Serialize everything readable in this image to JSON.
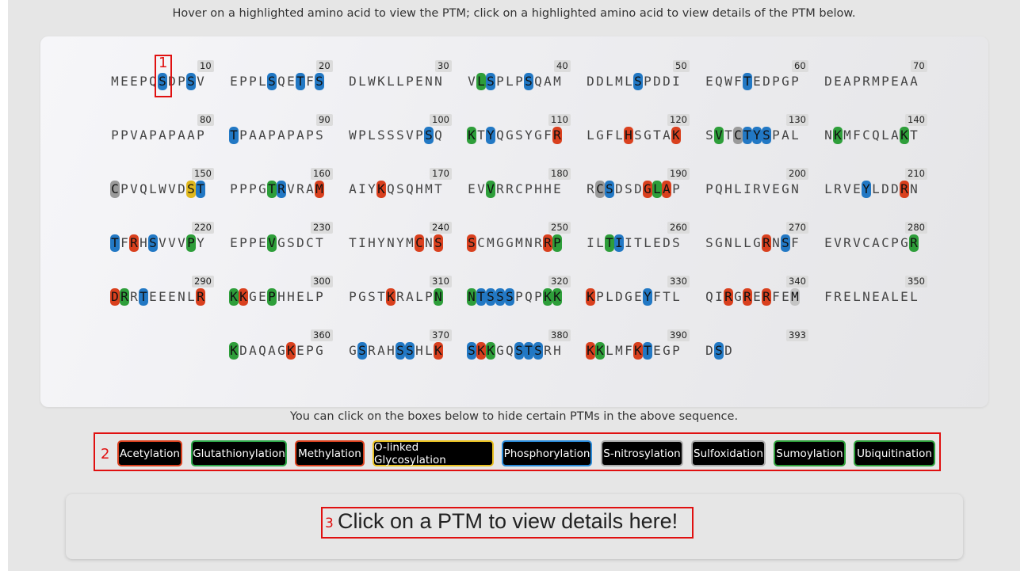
{
  "instructions": "Hover on a highlighted amino acid to view the PTM; click on a highlighted amino acid to view details of the PTM below.",
  "hint": "You can click on the boxes below to hide certain PTMs in the above sequence.",
  "details_prompt": "Click on a PTM to view details here!",
  "annotation_labels": [
    "1",
    "2",
    "3"
  ],
  "ptm_colors": {
    "Acetylation": "#d9401e",
    "Glutathionylation": "#2e9e3a",
    "Methylation": "#d9401e",
    "O-linked Glycosylation": "#e0b81e",
    "Phosphorylation": "#2278c4",
    "S-nitrosylation": "#9a9a9a",
    "Sulfoxidation": "#9a9a9a",
    "Sumoylation": "#2e9e3a",
    "Ubiquitination": "#2e9e3a",
    "Methionine-grey": "#c4c4c4"
  },
  "legend": [
    {
      "label": "Acetylation",
      "border": "#d9401e"
    },
    {
      "label": "Glutathionylation",
      "border": "#2ea84a"
    },
    {
      "label": "Methylation",
      "border": "#d9401e"
    },
    {
      "label": "O-linked Glycosylation",
      "border": "#e8c020"
    },
    {
      "label": "Phosphorylation",
      "border": "#2a8ad8"
    },
    {
      "label": "S-nitrosylation",
      "border": "#aaaaaa"
    },
    {
      "label": "Sulfoxidation",
      "border": "#aaaaaa"
    },
    {
      "label": "Sumoylation",
      "border": "#2e9e3a"
    },
    {
      "label": "Ubiquitination",
      "border": "#2e9e3a"
    }
  ],
  "sequence_chunks": [
    {
      "seq": "MEEPQSDPSV",
      "pos": "10",
      "hl": [
        [
          5,
          "b"
        ],
        [
          8,
          "b"
        ]
      ]
    },
    {
      "seq": "EPPLSQETFS",
      "pos": "20",
      "hl": [
        [
          4,
          "b"
        ],
        [
          7,
          "b"
        ],
        [
          9,
          "b"
        ]
      ]
    },
    {
      "seq": "DLWKLLPENN",
      "pos": "30",
      "hl": []
    },
    {
      "seq": "VLSPLPSQAM",
      "pos": "40",
      "hl": [
        [
          1,
          "g"
        ],
        [
          2,
          "b"
        ],
        [
          6,
          "b"
        ]
      ]
    },
    {
      "seq": "DDLMLSPDDI",
      "pos": "50",
      "hl": [
        [
          5,
          "b"
        ]
      ]
    },
    {
      "seq": "EQWFTEDPGP",
      "pos": "60",
      "hl": [
        [
          4,
          "b"
        ]
      ]
    },
    {
      "seq": "DEAPRMPEAA",
      "pos": "70",
      "hl": []
    },
    {
      "seq": "PPVAPAPAAP",
      "pos": "80",
      "hl": []
    },
    {
      "seq": "TPAAPAPAPS",
      "pos": "90",
      "hl": [
        [
          0,
          "b"
        ]
      ]
    },
    {
      "seq": "WPLSSSVPSQ",
      "pos": "100",
      "hl": [
        [
          8,
          "b"
        ]
      ]
    },
    {
      "seq": "KTYQGSYGFR",
      "pos": "110",
      "hl": [
        [
          0,
          "g"
        ],
        [
          2,
          "b"
        ],
        [
          9,
          "r"
        ]
      ]
    },
    {
      "seq": "LGFLHSGTAK",
      "pos": "120",
      "hl": [
        [
          4,
          "r"
        ],
        [
          9,
          "r"
        ]
      ]
    },
    {
      "seq": "SVTCTYSPAL",
      "pos": "130",
      "hl": [
        [
          1,
          "g"
        ],
        [
          3,
          "gray"
        ],
        [
          4,
          "b"
        ],
        [
          5,
          "b"
        ],
        [
          6,
          "b"
        ]
      ]
    },
    {
      "seq": "NKMFCQLAKT",
      "pos": "140",
      "hl": [
        [
          1,
          "g"
        ],
        [
          8,
          "g"
        ]
      ]
    },
    {
      "seq": "CPVQLWVDST",
      "pos": "150",
      "hl": [
        [
          0,
          "gray"
        ],
        [
          8,
          "y"
        ],
        [
          9,
          "b"
        ]
      ]
    },
    {
      "seq": "PPPGTRVRAM",
      "pos": "160",
      "hl": [
        [
          4,
          "g"
        ],
        [
          5,
          "b"
        ],
        [
          9,
          "r"
        ]
      ]
    },
    {
      "seq": "AIYKQSQHMT",
      "pos": "170",
      "hl": [
        [
          3,
          "r"
        ]
      ]
    },
    {
      "seq": "EVVRRCPHHE",
      "pos": "180",
      "hl": [
        [
          2,
          "g"
        ]
      ]
    },
    {
      "seq": "RCSDSDGLAP",
      "pos": "190",
      "hl": [
        [
          1,
          "gray"
        ],
        [
          2,
          "b"
        ],
        [
          6,
          "r"
        ],
        [
          7,
          "g"
        ],
        [
          8,
          "r"
        ]
      ]
    },
    {
      "seq": "PQHLIRVEGN",
      "pos": "200",
      "hl": []
    },
    {
      "seq": "LRVEYLDDRN",
      "pos": "210",
      "hl": [
        [
          4,
          "b"
        ],
        [
          8,
          "r"
        ]
      ]
    },
    {
      "seq": "TFRHSVVVPY",
      "pos": "220",
      "hl": [
        [
          0,
          "b"
        ],
        [
          2,
          "r"
        ],
        [
          4,
          "b"
        ],
        [
          8,
          "g"
        ]
      ]
    },
    {
      "seq": "EPPEVGSDCT",
      "pos": "230",
      "hl": [
        [
          4,
          "g"
        ]
      ]
    },
    {
      "seq": "TIHYNYMCNS",
      "pos": "240",
      "hl": [
        [
          7,
          "r"
        ],
        [
          9,
          "r"
        ]
      ]
    },
    {
      "seq": "SCMGGMNRRP",
      "pos": "250",
      "hl": [
        [
          0,
          "r"
        ],
        [
          8,
          "r"
        ],
        [
          9,
          "g"
        ]
      ]
    },
    {
      "seq": "ILTIITLEDS",
      "pos": "260",
      "hl": [
        [
          2,
          "g"
        ],
        [
          3,
          "b"
        ]
      ]
    },
    {
      "seq": "SGNLLGRNSF",
      "pos": "270",
      "hl": [
        [
          6,
          "r"
        ],
        [
          8,
          "b"
        ]
      ]
    },
    {
      "seq": "EVRVCACPGR",
      "pos": "280",
      "hl": [
        [
          9,
          "g"
        ]
      ]
    },
    {
      "seq": "DRRTEEENLR",
      "pos": "290",
      "hl": [
        [
          0,
          "r"
        ],
        [
          1,
          "g"
        ],
        [
          3,
          "b"
        ],
        [
          9,
          "r"
        ]
      ]
    },
    {
      "seq": "KKGEPHHELP",
      "pos": "300",
      "hl": [
        [
          0,
          "g"
        ],
        [
          1,
          "r"
        ],
        [
          4,
          "g"
        ]
      ]
    },
    {
      "seq": "PGSTKRALPN",
      "pos": "310",
      "hl": [
        [
          4,
          "r"
        ],
        [
          9,
          "g"
        ]
      ]
    },
    {
      "seq": "NTSSSPQPKK",
      "pos": "320",
      "hl": [
        [
          0,
          "g"
        ],
        [
          1,
          "b"
        ],
        [
          2,
          "b"
        ],
        [
          3,
          "b"
        ],
        [
          4,
          "b"
        ],
        [
          8,
          "g"
        ],
        [
          9,
          "g"
        ]
      ]
    },
    {
      "seq": "KPLDGEYFTL",
      "pos": "330",
      "hl": [
        [
          0,
          "r"
        ],
        [
          6,
          "b"
        ]
      ]
    },
    {
      "seq": "QIRGRERFEM",
      "pos": "340",
      "hl": [
        [
          2,
          "r"
        ],
        [
          4,
          "r"
        ],
        [
          6,
          "r"
        ],
        [
          9,
          "gl"
        ]
      ]
    },
    {
      "seq": "FRELNEALEL",
      "pos": "350",
      "hl": []
    },
    {
      "seq": "KDAQAGKEPG",
      "pos": "360",
      "hl": [
        [
          0,
          "g"
        ],
        [
          6,
          "r"
        ]
      ]
    },
    {
      "seq": "GSRAHSSHLK",
      "pos": "370",
      "hl": [
        [
          1,
          "b"
        ],
        [
          5,
          "b"
        ],
        [
          6,
          "b"
        ],
        [
          9,
          "r"
        ]
      ]
    },
    {
      "seq": "SKKGQSTSRH",
      "pos": "380",
      "hl": [
        [
          0,
          "b"
        ],
        [
          1,
          "r"
        ],
        [
          2,
          "g"
        ],
        [
          5,
          "b"
        ],
        [
          6,
          "b"
        ],
        [
          7,
          "b"
        ]
      ]
    },
    {
      "seq": "KKLMFKTEGP",
      "pos": "390",
      "hl": [
        [
          0,
          "r"
        ],
        [
          1,
          "g"
        ],
        [
          5,
          "r"
        ],
        [
          6,
          "b"
        ]
      ]
    },
    {
      "seq": "DSD",
      "pos": "393",
      "hl": [
        [
          1,
          "b"
        ]
      ]
    }
  ]
}
